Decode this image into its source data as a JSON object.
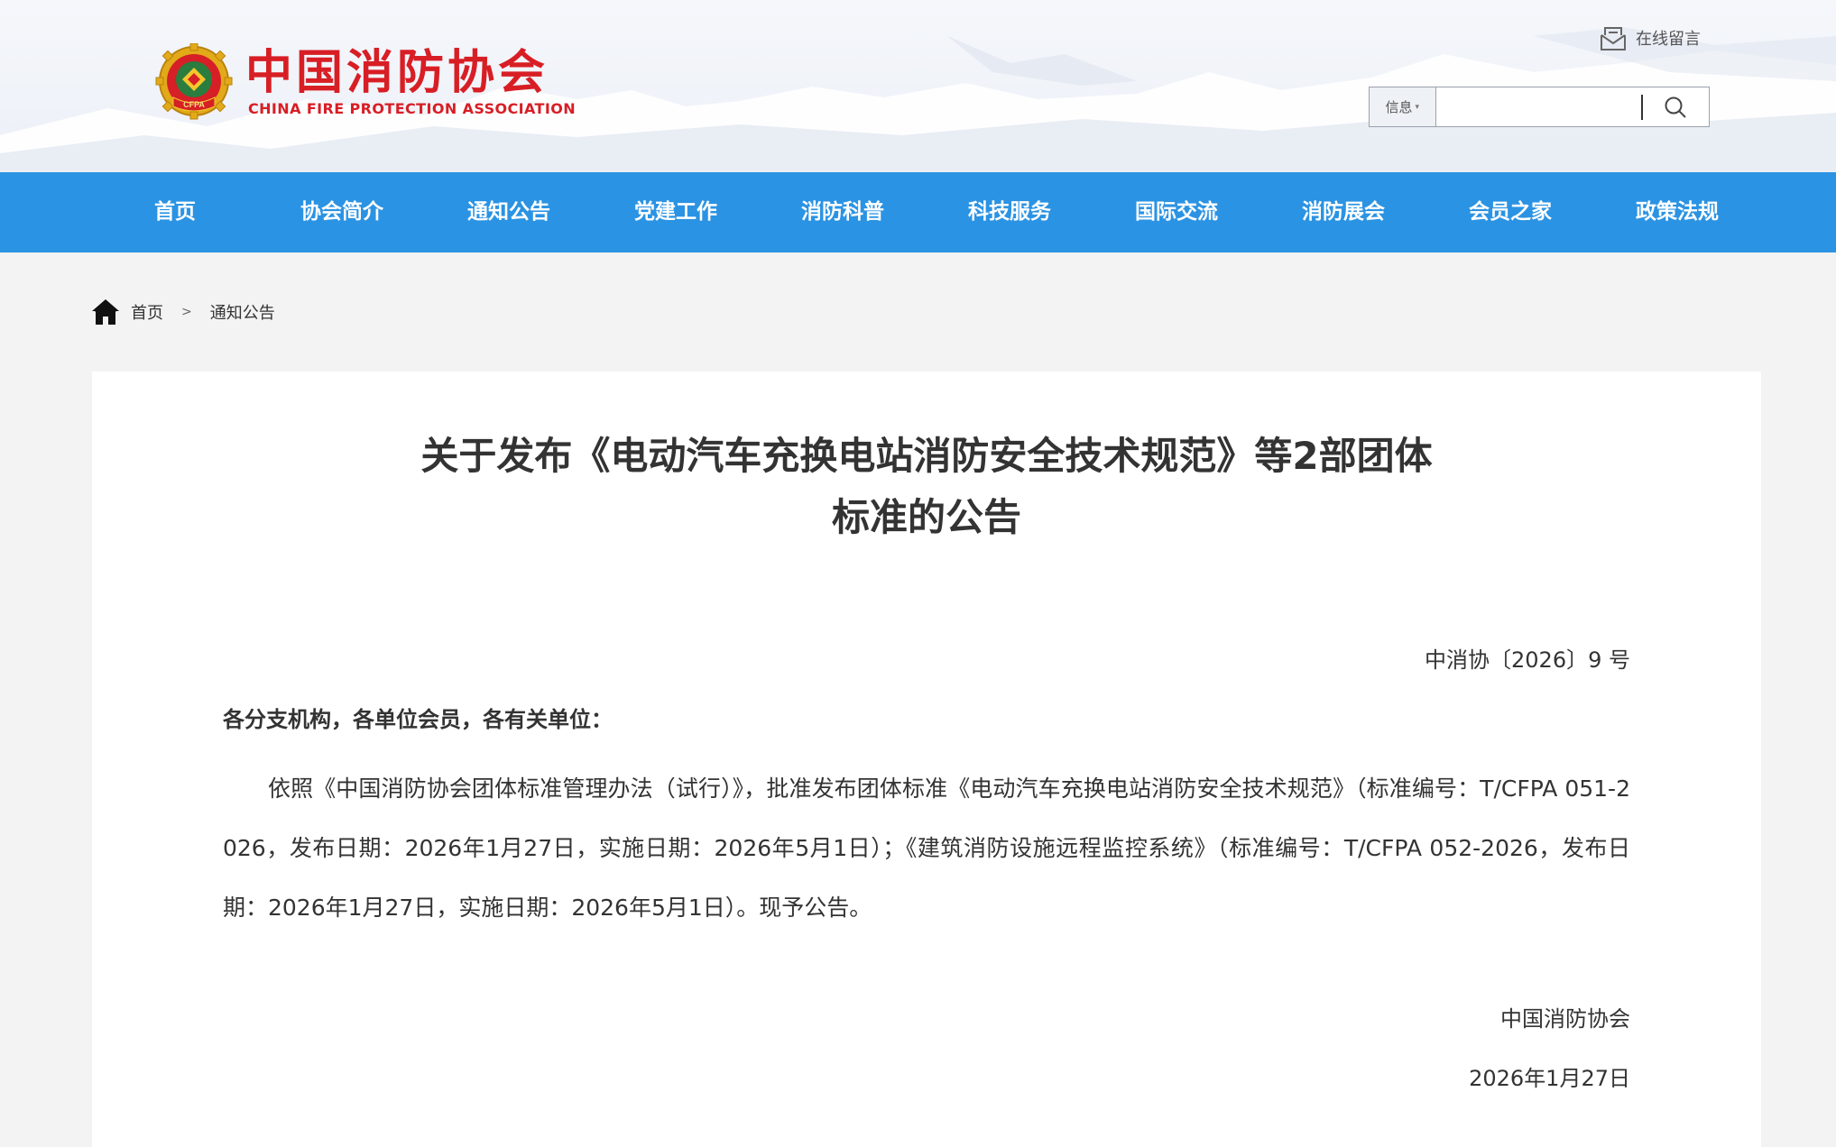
{
  "header": {
    "site_title": "中国消防协会",
    "site_subtitle": "CHINA FIRE PROTECTION ASSOCIATION",
    "logo_text": "CFPA",
    "message_link": "在线留言",
    "search": {
      "category": "信息",
      "value": "",
      "placeholder": ""
    }
  },
  "nav": {
    "items": [
      {
        "label": "首页"
      },
      {
        "label": "协会简介"
      },
      {
        "label": "通知公告"
      },
      {
        "label": "党建工作"
      },
      {
        "label": "消防科普"
      },
      {
        "label": "科技服务"
      },
      {
        "label": "国际交流"
      },
      {
        "label": "消防展会"
      },
      {
        "label": "会员之家"
      },
      {
        "label": "政策法规"
      }
    ]
  },
  "breadcrumb": {
    "home": "首页",
    "separator": ">",
    "current": "通知公告"
  },
  "article": {
    "title_line1": "关于发布《电动汽车充换电站消防安全技术规范》等2部团体",
    "title_line2": "标准的公告",
    "doc_number": "中消协〔2026〕9 号",
    "salutation": "各分支机构，各单位会员，各有关单位：",
    "body": "依照《中国消防协会团体标准管理办法（试行）》，批准发布团体标准《电动汽车充换电站消防安全技术规范》（标准编号：T/CFPA 051-2026，发布日期：2026年1月27日，实施日期：2026年5月1日）；《建筑消防设施远程监控系统》（标准编号：T/CFPA 052-2026，发布日期：2026年1月27日，实施日期：2026年5月1日）。现予公告。",
    "signature": "中国消防协会",
    "date": "2026年1月27日"
  },
  "colors": {
    "brand_red": "#d81e25",
    "nav_blue": "#2b93e3",
    "text": "#333333"
  }
}
